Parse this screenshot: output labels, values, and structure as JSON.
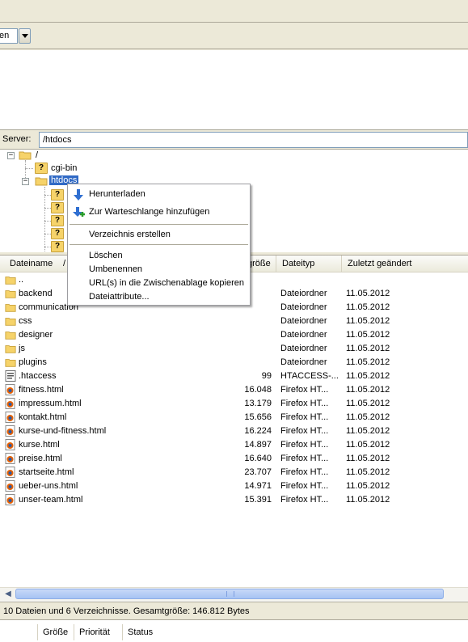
{
  "toolbar": {
    "combo_value": "en"
  },
  "server_path": {
    "label": "Server:",
    "value": "/htdocs"
  },
  "tree": {
    "root": "/",
    "children": [
      {
        "label": "cgi-bin"
      },
      {
        "label": "htdocs",
        "selected": true
      }
    ]
  },
  "file_list": {
    "columns": [
      "Dateiname",
      "/",
      "größe",
      "Dateityp",
      "Zuletzt geändert"
    ],
    "rows": [
      {
        "name": "..",
        "size": "",
        "type": "",
        "modified": "",
        "icon": "folder-icon"
      },
      {
        "name": "backend",
        "size": "",
        "type": "Dateiordner",
        "modified": "11.05.2012",
        "icon": "folder-icon"
      },
      {
        "name": "communication",
        "size": "",
        "type": "Dateiordner",
        "modified": "11.05.2012",
        "icon": "folder-icon"
      },
      {
        "name": "css",
        "size": "",
        "type": "Dateiordner",
        "modified": "11.05.2012",
        "icon": "folder-icon"
      },
      {
        "name": "designer",
        "size": "",
        "type": "Dateiordner",
        "modified": "11.05.2012",
        "icon": "folder-icon"
      },
      {
        "name": "js",
        "size": "",
        "type": "Dateiordner",
        "modified": "11.05.2012",
        "icon": "folder-icon"
      },
      {
        "name": "plugins",
        "size": "",
        "type": "Dateiordner",
        "modified": "11.05.2012",
        "icon": "folder-icon"
      },
      {
        "name": ".htaccess",
        "size": "99",
        "type": "HTACCESS-...",
        "modified": "11.05.2012",
        "icon": "file-icon"
      },
      {
        "name": "fitness.html",
        "size": "16.048",
        "type": "Firefox HT...",
        "modified": "11.05.2012",
        "icon": "firefox-html-icon"
      },
      {
        "name": "impressum.html",
        "size": "13.179",
        "type": "Firefox HT...",
        "modified": "11.05.2012",
        "icon": "firefox-html-icon"
      },
      {
        "name": "kontakt.html",
        "size": "15.656",
        "type": "Firefox HT...",
        "modified": "11.05.2012",
        "icon": "firefox-html-icon"
      },
      {
        "name": "kurse-und-fitness.html",
        "size": "16.224",
        "type": "Firefox HT...",
        "modified": "11.05.2012",
        "icon": "firefox-html-icon"
      },
      {
        "name": "kurse.html",
        "size": "14.897",
        "type": "Firefox HT...",
        "modified": "11.05.2012",
        "icon": "firefox-html-icon"
      },
      {
        "name": "preise.html",
        "size": "16.640",
        "type": "Firefox HT...",
        "modified": "11.05.2012",
        "icon": "firefox-html-icon"
      },
      {
        "name": "startseite.html",
        "size": "23.707",
        "type": "Firefox HT...",
        "modified": "11.05.2012",
        "icon": "firefox-html-icon"
      },
      {
        "name": "ueber-uns.html",
        "size": "14.971",
        "type": "Firefox HT...",
        "modified": "11.05.2012",
        "icon": "firefox-html-icon"
      },
      {
        "name": "unser-team.html",
        "size": "15.391",
        "type": "Firefox HT...",
        "modified": "11.05.2012",
        "icon": "firefox-html-icon"
      }
    ]
  },
  "context_menu": {
    "items": [
      {
        "label": "Herunterladen",
        "icon": "download-icon"
      },
      {
        "label": "Zur Warteschlange hinzufügen",
        "icon": "add-to-queue-icon"
      },
      {
        "label": "Verzeichnis erstellen"
      },
      {
        "label": "Löschen"
      },
      {
        "label": "Umbenennen"
      },
      {
        "label": "URL(s) in die Zwischenablage kopieren"
      },
      {
        "label": "Dateiattribute..."
      }
    ]
  },
  "scrollbar": {
    "grip": "|||"
  },
  "status": {
    "summary": "10 Dateien und 6 Verzeichnisse. Gesamtgröße: 146.812 Bytes"
  },
  "queue": {
    "columns": [
      "Größe",
      "Priorität",
      "Status"
    ]
  },
  "colors": {
    "selection": "#316ac5",
    "chrome": "#ece9d8",
    "folder": "#f6d36a"
  }
}
